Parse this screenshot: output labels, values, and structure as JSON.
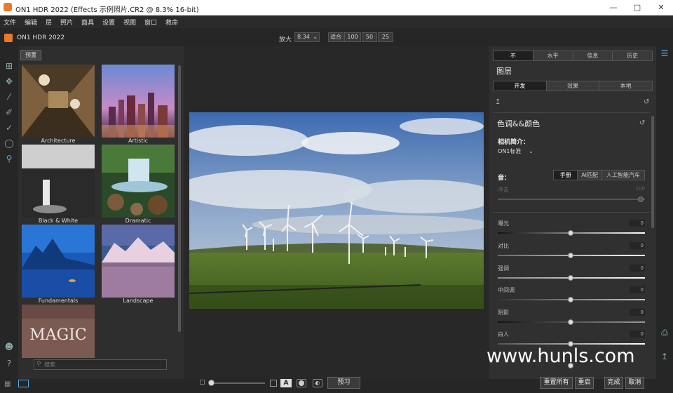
{
  "window": {
    "title": "ON1 HDR 2022 (Effects 示例照片.CR2 @ 8.3% 16-bit)"
  },
  "menu": [
    "文件",
    "编辑",
    "层",
    "照片",
    "面具",
    "设置",
    "视图",
    "窗口",
    "救命"
  ],
  "app": {
    "name": "ON1 HDR 2022"
  },
  "zoom": {
    "label": "放大",
    "value": "8.34",
    "fit": "适合",
    "z100": "100",
    "z50": "50",
    "z25": "25"
  },
  "browser": {
    "preset_button": "预置",
    "categories": [
      "Architecture",
      "Artistic",
      "Black & White",
      "Dramatic",
      "Fundamentals",
      "Landscape"
    ],
    "magic_text": "MAGIC",
    "search_placeholder": "搜索"
  },
  "panel": {
    "top_tabs": [
      "不",
      "水平",
      "信息",
      "历史"
    ],
    "layers_title": "图层",
    "sub_tabs": [
      "开发",
      "效果",
      "本地"
    ],
    "section_title": "色调&&颜色",
    "camera_profile_label": "相机简介：",
    "camera_profile_value": "ON1标准",
    "tone_label": "音：",
    "tone_modes": [
      "手册",
      "AI匹配",
      "人工智能汽车"
    ],
    "amount_label": "冲击",
    "amount_value": "100",
    "sliders": [
      {
        "label": "曝光",
        "value": "0"
      },
      {
        "label": "对比",
        "value": "0"
      },
      {
        "label": "强调",
        "value": "0"
      },
      {
        "label": "中间调",
        "value": "0"
      },
      {
        "label": "阴影",
        "value": "0"
      },
      {
        "label": "白人",
        "value": "0"
      }
    ]
  },
  "bottom": {
    "preview": "预习",
    "reset_all": "重置所有",
    "reset": "重启",
    "done": "完成",
    "cancel": "取消"
  },
  "watermark": "www.hunls.com",
  "colors": {
    "accent": "#e87a2a",
    "icon": "#5aa9e6"
  }
}
